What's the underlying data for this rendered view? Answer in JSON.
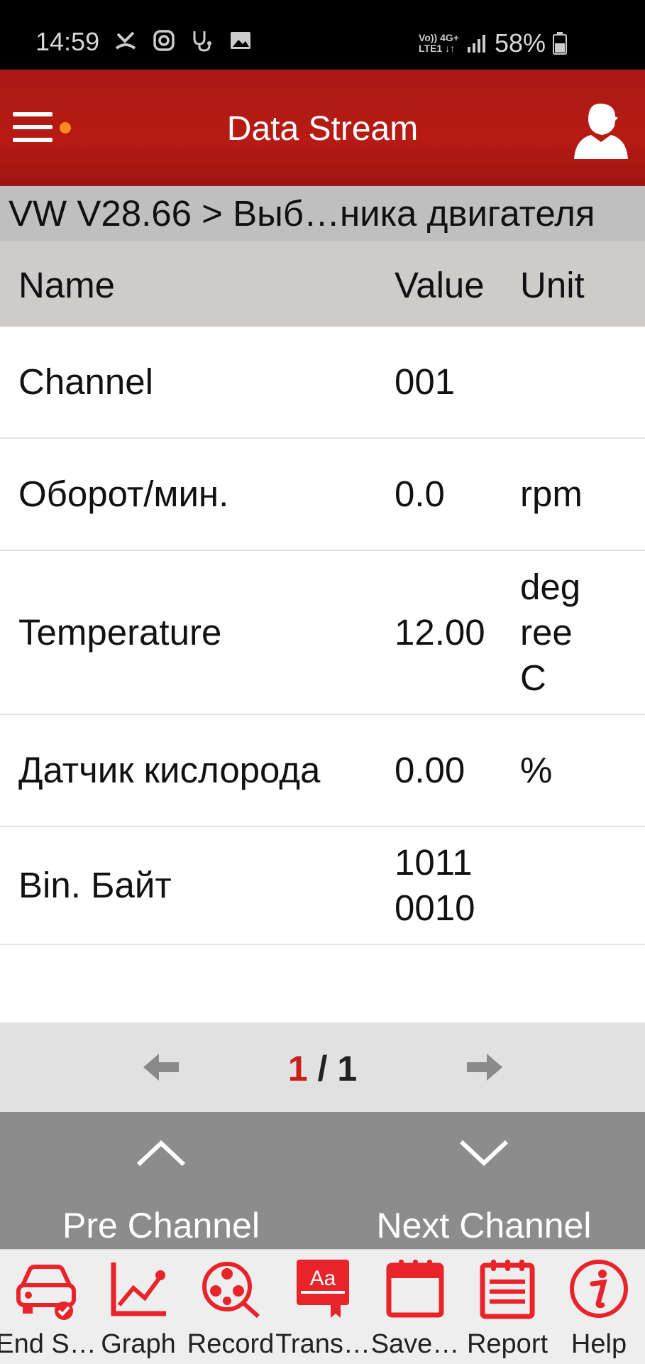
{
  "status_bar": {
    "time": "14:59",
    "net_top": "Vo)) 4G+",
    "net_bottom": "LTE1 ↓↑",
    "battery": "58%"
  },
  "header": {
    "title": "Data Stream"
  },
  "breadcrumb": "VW V28.66 > Выб…ника двигателя",
  "table": {
    "columns": {
      "name": "Name",
      "value": "Value",
      "unit": "Unit"
    },
    "rows": [
      {
        "name": "Channel",
        "value": "001",
        "unit": ""
      },
      {
        "name": "Оборот/мин.",
        "value": "0.0",
        "unit": "rpm"
      },
      {
        "name": "Temperature",
        "value": "12.00",
        "unit": "deg\nree\nC"
      },
      {
        "name": "Датчик кислорода",
        "value": "0.00",
        "unit": "%"
      },
      {
        "name": "Bin. Байт",
        "value": "1011\n0010",
        "unit": ""
      }
    ]
  },
  "pager": {
    "current": "1",
    "separator": " / ",
    "total": "1"
  },
  "channel_nav": {
    "prev_label": "Pre Channel",
    "next_label": "Next Channel"
  },
  "toolbar": {
    "items": [
      {
        "label": "End S…",
        "icon": "car-check-icon"
      },
      {
        "label": "Graph",
        "icon": "graph-icon"
      },
      {
        "label": "Record",
        "icon": "record-reel-icon"
      },
      {
        "label": "Trans…",
        "icon": "translate-icon"
      },
      {
        "label": "Save…",
        "icon": "calendar-save-icon"
      },
      {
        "label": "Report",
        "icon": "report-icon"
      },
      {
        "label": "Help",
        "icon": "info-icon"
      }
    ]
  },
  "colors": {
    "accent": "#b81a14",
    "icon_red": "#e8242a",
    "page_current": "#c8201a"
  }
}
